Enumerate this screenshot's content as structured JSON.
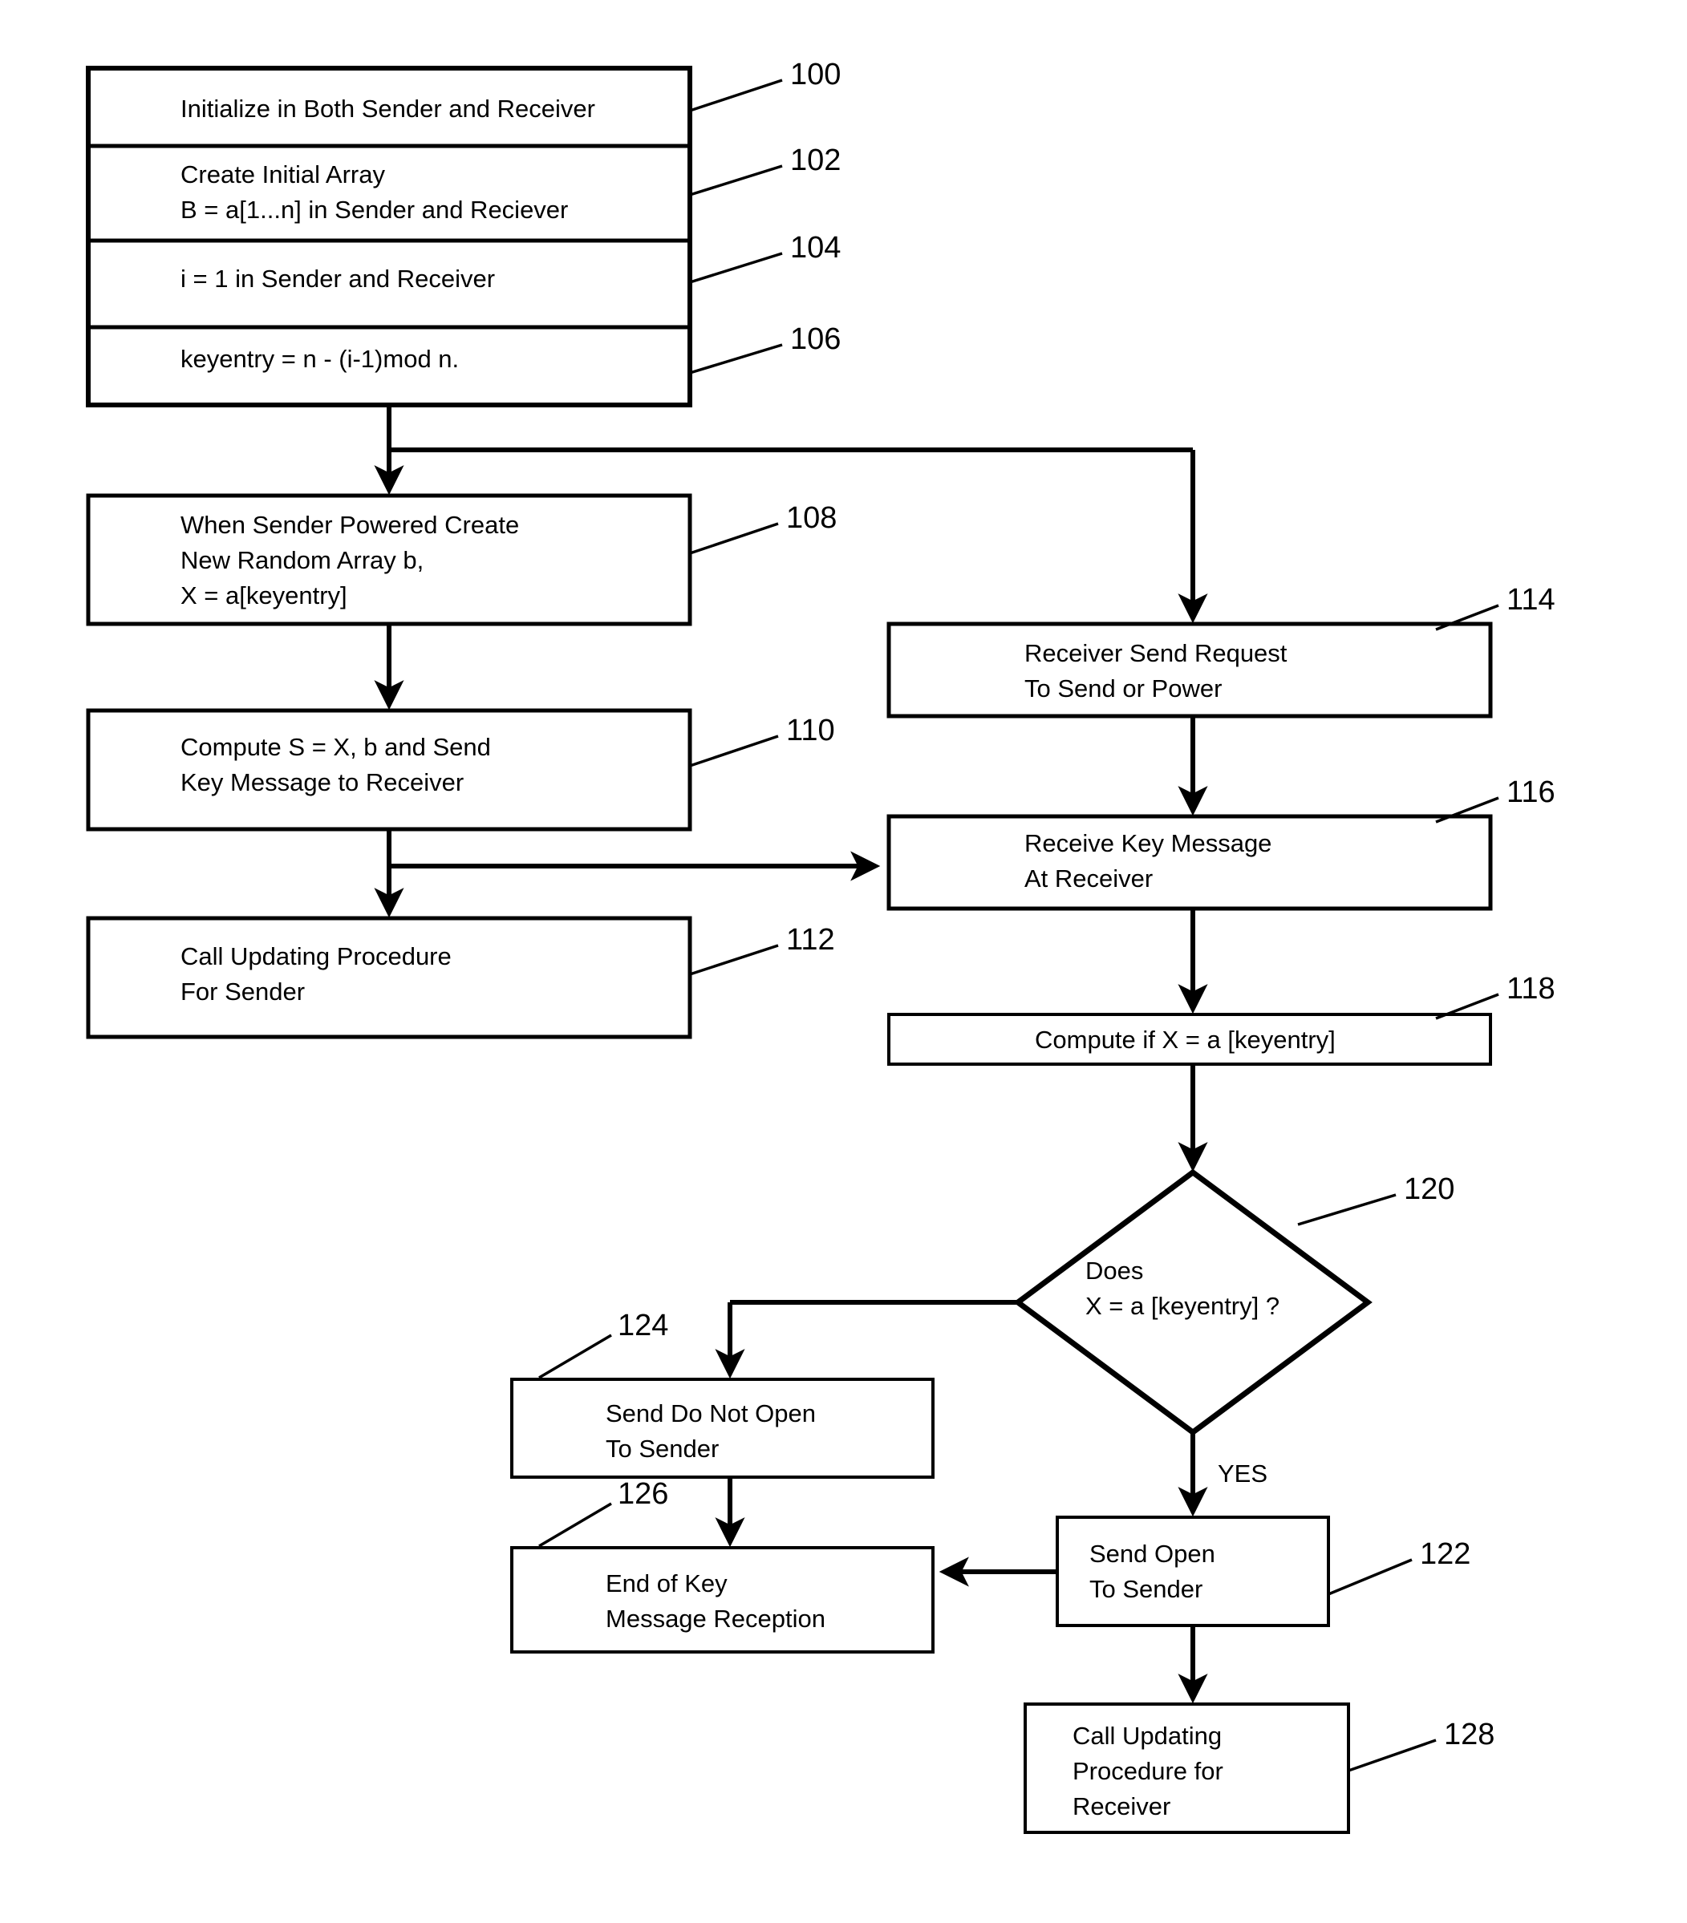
{
  "figure": {
    "title": "Key message exchange flowchart between Sender and Receiver",
    "type": "flowchart",
    "background_color": "#ffffff",
    "line_color": "#000000"
  },
  "nodes": [
    {
      "ref": "100",
      "shape": "rectangle",
      "lines": [
        "Initialize in Both Sender and Receiver"
      ]
    },
    {
      "ref": "102",
      "shape": "rectangle",
      "lines": [
        "Create Initial Array",
        "B = a[1...n] in Sender and Reciever"
      ]
    },
    {
      "ref": "104",
      "shape": "rectangle",
      "lines": [
        "i = 1 in Sender and Receiver"
      ]
    },
    {
      "ref": "106",
      "shape": "rectangle",
      "lines": [
        "keyentry = n - (i-1)mod n."
      ]
    },
    {
      "ref": "108",
      "shape": "rectangle",
      "lines": [
        "When Sender Powered Create",
        "New Random Array b,",
        "X = a[keyentry]"
      ]
    },
    {
      "ref": "110",
      "shape": "rectangle",
      "lines": [
        "Compute S = X, b and Send",
        "Key Message to Receiver"
      ]
    },
    {
      "ref": "112",
      "shape": "rectangle",
      "lines": [
        "Call Updating Procedure",
        "For Sender"
      ]
    },
    {
      "ref": "114",
      "shape": "rectangle",
      "lines": [
        "Receiver Send Request",
        "To Send or Power"
      ]
    },
    {
      "ref": "116",
      "shape": "rectangle",
      "lines": [
        "Receive Key Message",
        "At Receiver"
      ]
    },
    {
      "ref": "118",
      "shape": "rectangle",
      "lines": [
        "Compute if X = a [keyentry]"
      ]
    },
    {
      "ref": "120",
      "shape": "diamond",
      "lines": [
        "Does",
        "X = a [keyentry] ?"
      ]
    },
    {
      "ref": "122",
      "shape": "rectangle",
      "lines": [
        "Send Open",
        "To Sender"
      ]
    },
    {
      "ref": "124",
      "shape": "rectangle",
      "lines": [
        "Send Do Not Open",
        "To Sender"
      ]
    },
    {
      "ref": "126",
      "shape": "rectangle",
      "lines": [
        "End of Key",
        "Message Reception"
      ]
    },
    {
      "ref": "128",
      "shape": "rectangle",
      "lines": [
        "Call Updating",
        "Procedure for",
        "Receiver"
      ]
    }
  ],
  "edge_labels": [
    {
      "id": "yes",
      "text": "YES"
    }
  ],
  "ref_labels": {
    "n100": "100",
    "n102": "102",
    "n104": "104",
    "n106": "106",
    "n108": "108",
    "n110": "110",
    "n112": "112",
    "n114": "114",
    "n116": "116",
    "n118": "118",
    "n120": "120",
    "n122": "122",
    "n124": "124",
    "n126": "126",
    "n128": "128"
  },
  "text": {
    "n100_l1": "Initialize in Both Sender and Receiver",
    "n102_l1": "Create Initial Array",
    "n102_l2": "B = a[1...n] in Sender and Reciever",
    "n104_l1": "i = 1 in Sender and Receiver",
    "n106_l1": "keyentry = n - (i-1)mod n.",
    "n108_l1": "When Sender Powered Create",
    "n108_l2": "New Random Array b,",
    "n108_l3": "X = a[keyentry]",
    "n110_l1": "Compute S = X, b and Send",
    "n110_l2": "Key Message to Receiver",
    "n112_l1": "Call Updating Procedure",
    "n112_l2": "For Sender",
    "n114_l1": "Receiver Send Request",
    "n114_l2": "To Send or Power",
    "n116_l1": "Receive Key Message",
    "n116_l2": "At Receiver",
    "n118_l1": "Compute if X = a [keyentry]",
    "n120_l1": "Does",
    "n120_l2": "X = a [keyentry] ?",
    "n122_l1": "Send Open",
    "n122_l2": "To Sender",
    "n124_l1": "Send Do Not Open",
    "n124_l2": "To Sender",
    "n126_l1": "End of Key",
    "n126_l2": "Message Reception",
    "n128_l1": "Call Updating",
    "n128_l2": "Procedure for",
    "n128_l3": "Receiver",
    "yes_label": "YES"
  }
}
